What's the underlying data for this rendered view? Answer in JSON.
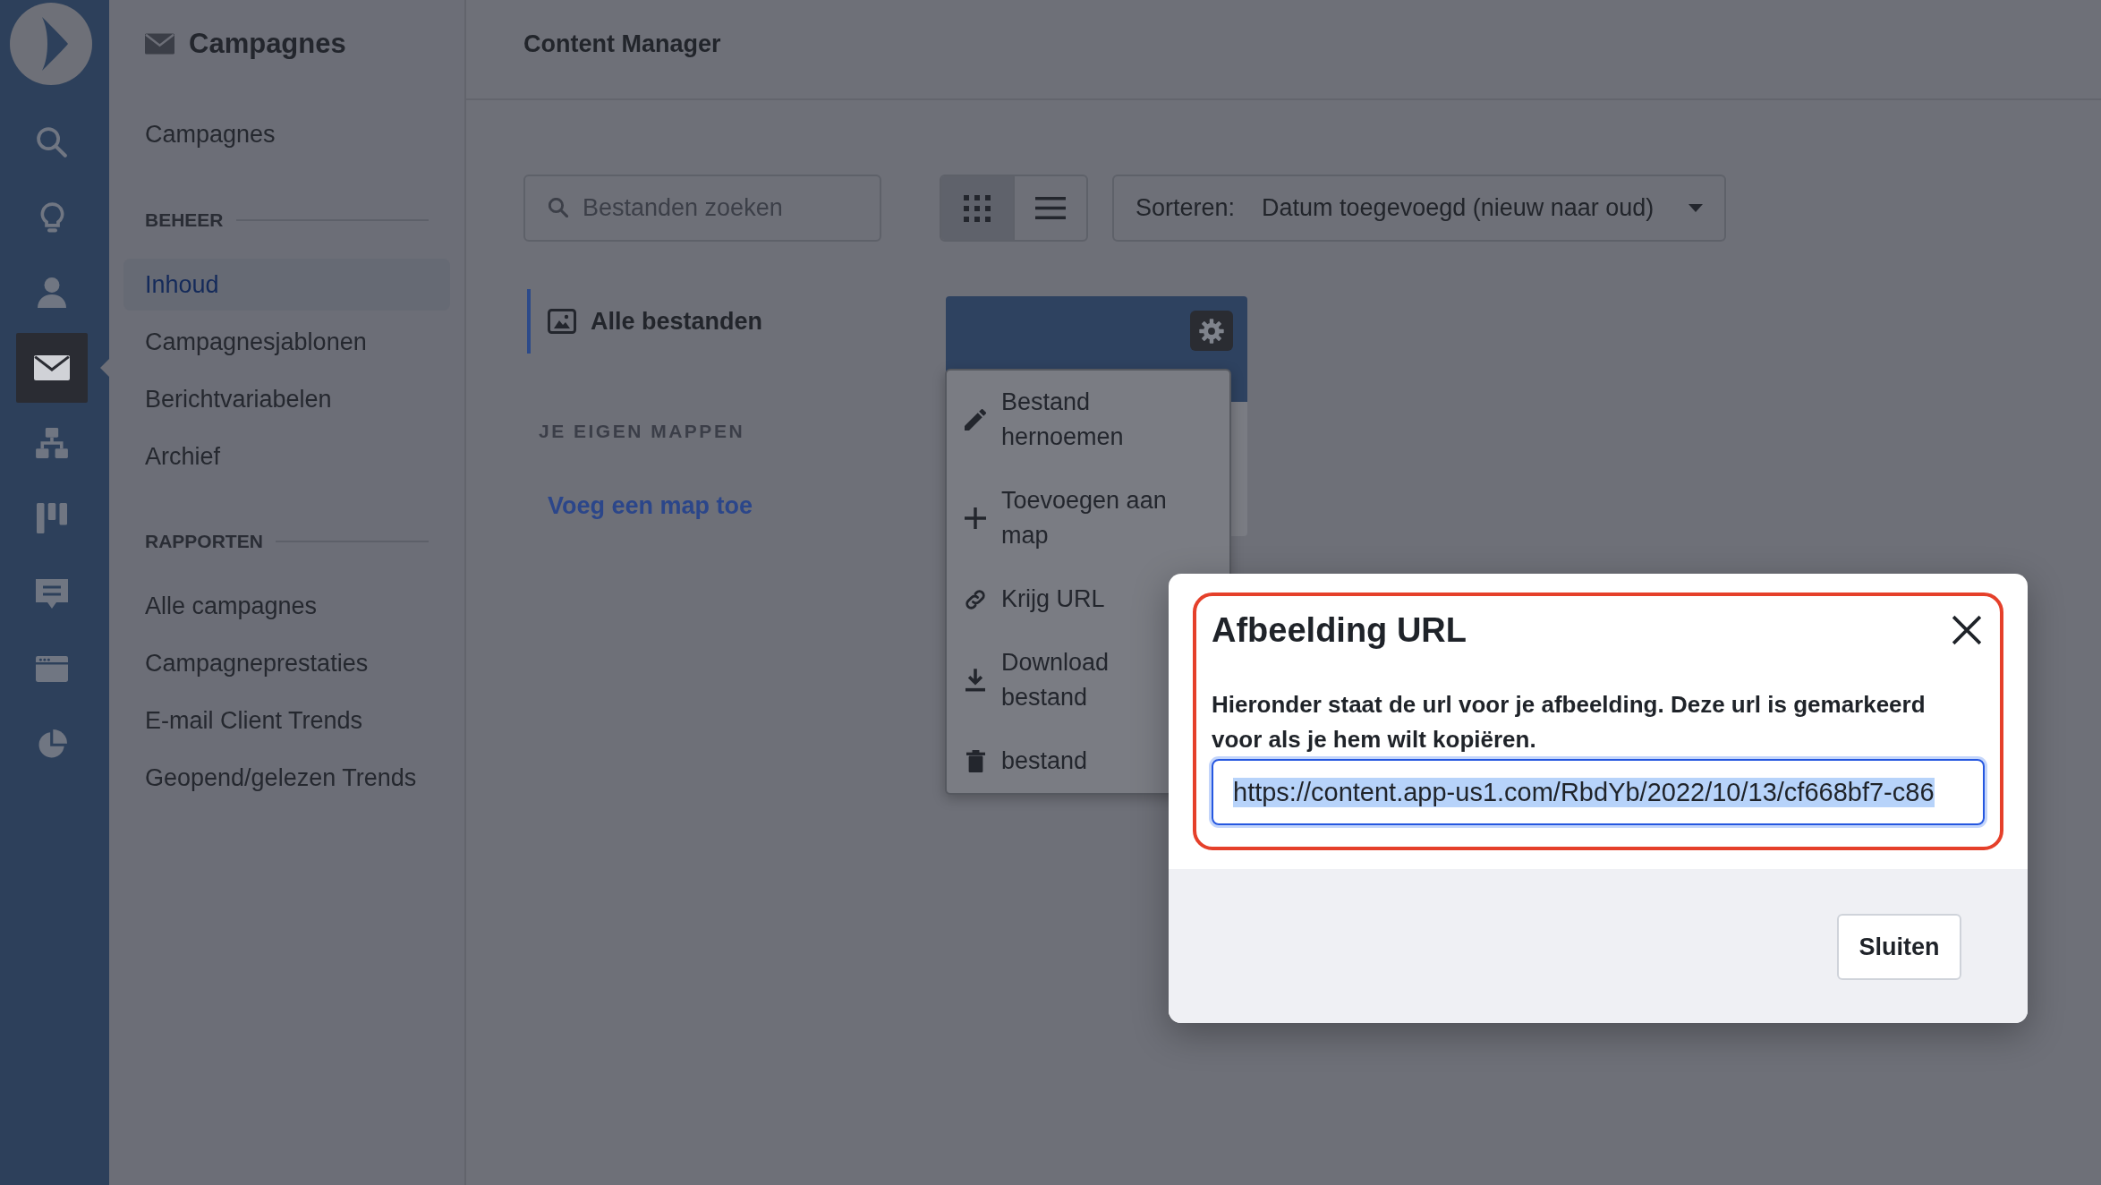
{
  "rail": {
    "items": [
      {
        "selected": false
      },
      {
        "selected": false
      },
      {
        "selected": false
      },
      {
        "selected": true
      },
      {
        "selected": false
      },
      {
        "selected": false
      },
      {
        "selected": false
      },
      {
        "selected": false
      },
      {
        "selected": false
      }
    ]
  },
  "sidebar": {
    "title": "Campagnes",
    "items": [
      {
        "label": "Campagnes",
        "selected": false
      }
    ],
    "sections": [
      {
        "heading": "BEHEER",
        "items": [
          {
            "label": "Inhoud",
            "selected": true
          },
          {
            "label": "Campagnesjablonen",
            "selected": false
          },
          {
            "label": "Berichtvariabelen",
            "selected": false
          },
          {
            "label": "Archief",
            "selected": false
          }
        ]
      },
      {
        "heading": "RAPPORTEN",
        "items": [
          {
            "label": "Alle campagnes",
            "selected": false
          },
          {
            "label": "Campagneprestaties",
            "selected": false
          },
          {
            "label": "E-mail Client Trends",
            "selected": false
          },
          {
            "label": "Geopend/gelezen Trends",
            "selected": false
          }
        ]
      }
    ]
  },
  "header": {
    "title": "Content Manager"
  },
  "toolbar": {
    "search": {
      "placeholder": "Bestanden zoeken"
    },
    "views": [
      {
        "selected": true
      },
      {
        "selected": false
      }
    ],
    "sort": {
      "label": "Sorteren:",
      "value": "Datum toegevoegd (nieuw naar oud)"
    }
  },
  "folders": {
    "items": [
      {
        "label": "Alle bestanden",
        "selected": true
      }
    ],
    "heading": "JE EIGEN MAPPEN",
    "add_link": "Voeg een map toe"
  },
  "file_menu": {
    "open": true,
    "items": [
      {
        "label": "Bestand hernoemen"
      },
      {
        "label": "Toevoegen aan map"
      },
      {
        "label": "Krijg URL"
      },
      {
        "label": "Download bestand"
      },
      {
        "label": "bestand"
      }
    ]
  },
  "dialog": {
    "title": "Afbeelding URL",
    "highlighted": true,
    "message": "Hieronder staat de url voor je afbeelding. Deze url is gemarkeerd voor als je hem wilt kopiëren.",
    "url_field": {
      "value": "https://content.app-us1.com/RbdYb/2022/10/13/cf668bf7-c86",
      "focused": true,
      "text_selected": true
    },
    "buttons": [
      "Sluiten"
    ]
  }
}
